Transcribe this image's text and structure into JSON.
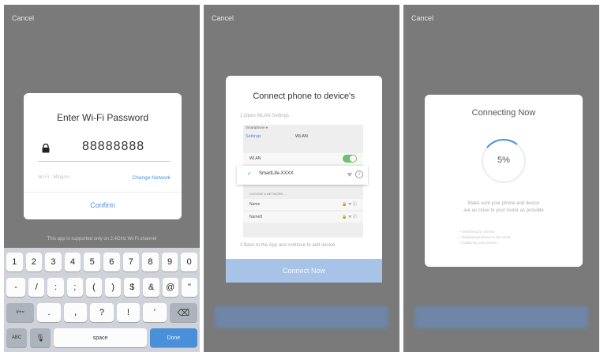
{
  "screens": {
    "enter_password": {
      "cancel_label": "Cancel",
      "title": "Enter Wi-Fi Password",
      "password_value": "88888888",
      "wifi_name": "Wi-Fi - Mingmo",
      "change_network_label": "Change Network",
      "confirm_label": "Confirm",
      "hint": "This app is supported only on 2.4GHz Wi-Fi channel"
    },
    "connect_phone": {
      "cancel_label": "Cancel",
      "title": "Connect phone to device's",
      "step1": "1.Open WLAN Settings",
      "step2": "2.Back to the App and continue to add device",
      "button_label": "Connect Now",
      "screenshot": {
        "status_bar": "Smartphone ♦",
        "back_label": "Settings",
        "nav_title": "WLAN",
        "wlan_label": "WLAN",
        "selected_network": "SmartLife-XXXX",
        "choose_label": "CHOOSE A NETWORK...",
        "networks": [
          "Name",
          "Name8"
        ]
      }
    },
    "connecting": {
      "cancel_label": "Cancel",
      "title": "Connecting Now",
      "percent_label": "5%",
      "progress": 0.05,
      "message_line1": "Make sure your phone and device",
      "message_line2": "are as close to your router as possible",
      "steps": [
        "Searching for Device",
        "Registering device to the cloud",
        "Initializing your Device"
      ]
    }
  },
  "keyboard": {
    "row1": [
      "1",
      "2",
      "3",
      "4",
      "5",
      "6",
      "7",
      "8",
      "9",
      "0"
    ],
    "row2": [
      "-",
      "/",
      ":",
      ";",
      "(",
      ")",
      "$",
      "&",
      "@",
      "\""
    ],
    "row3": [
      "#+=",
      ".",
      ",",
      "?",
      "!",
      "'",
      "⌫"
    ],
    "abc_label": "ABC",
    "mic_icon": "🎙",
    "space_label": "space",
    "done_label": "Done"
  },
  "colors": {
    "accent": "#4a90d9",
    "overlay": "#7a7a7a",
    "connect_button": "#a7c4e8"
  }
}
